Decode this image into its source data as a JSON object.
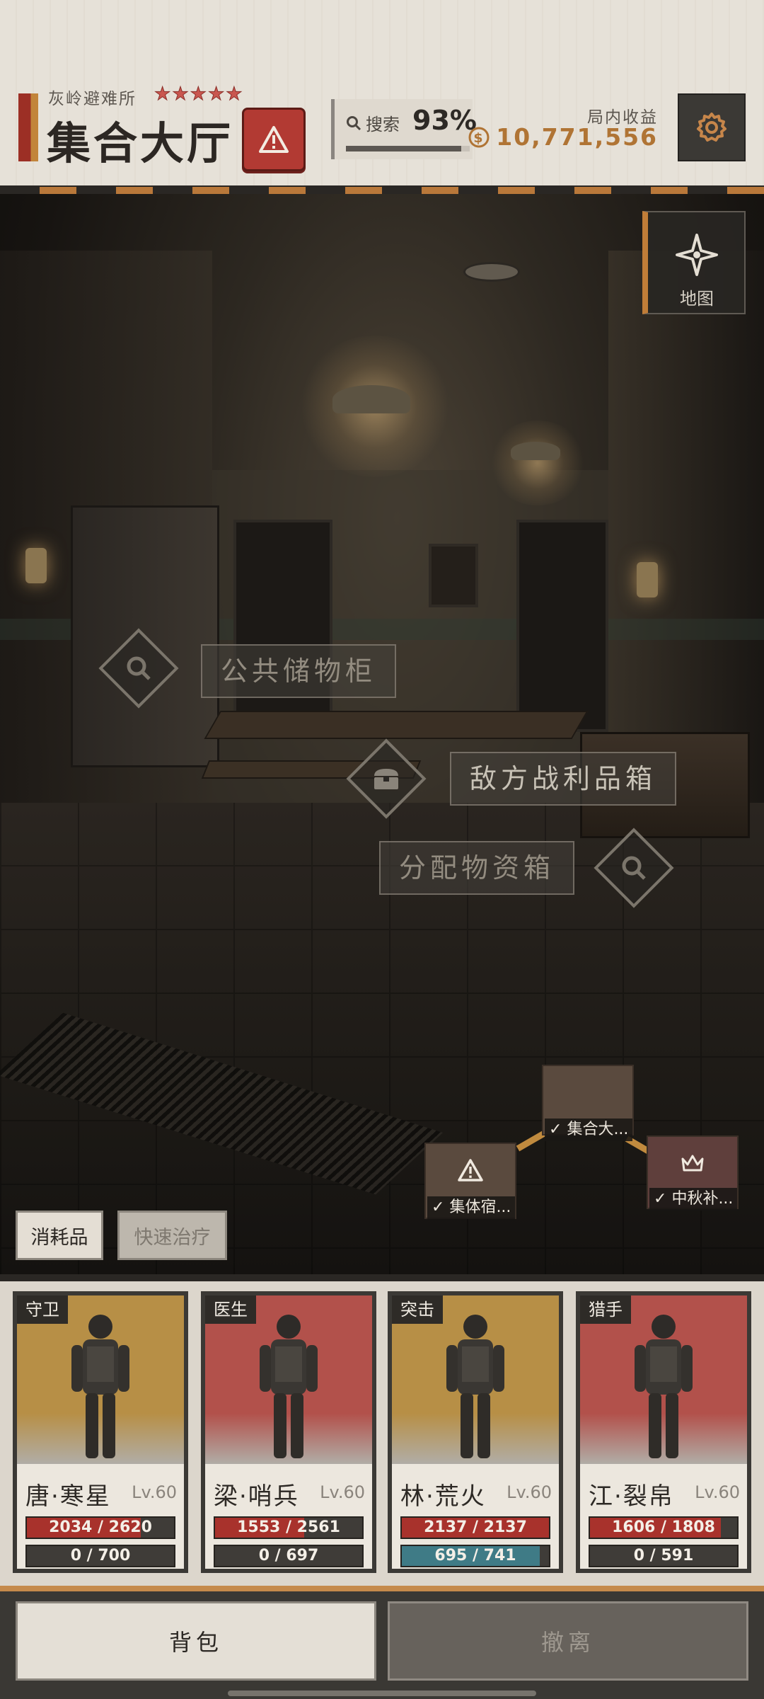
{
  "header": {
    "shelter_name": "灰岭避难所",
    "stars": [
      "★",
      "★",
      "★",
      "★",
      "★"
    ],
    "room_title": "集合大厅",
    "search_label": "搜索",
    "search_pct": "93%",
    "search_progress": 0.93,
    "income_label": "局内收益",
    "income_value": "10,771,556"
  },
  "scene": {
    "map_label": "地图",
    "locations": {
      "locker": "公共储物柜",
      "enemy_loot": "敌方战利品箱",
      "supply": "分配物资箱"
    }
  },
  "minimap": {
    "node_hall": "集合大...",
    "node_dorm": "集体宿...",
    "node_mid": "中秋补..."
  },
  "actions": {
    "consumables": "消耗品",
    "quick_heal": "快速治疗"
  },
  "squad": [
    {
      "role": "守卫",
      "name": "唐·寒星",
      "level": "Lv.60",
      "hp": "2034 / 2620",
      "hp_ratio": 0.776,
      "sp": "0 / 700",
      "sp_ratio": 0,
      "bg": "#b78f46"
    },
    {
      "role": "医生",
      "name": "梁·哨兵",
      "level": "Lv.60",
      "hp": "1553 / 2561",
      "hp_ratio": 0.606,
      "sp": "0 / 697",
      "sp_ratio": 0,
      "bg": "#b2514b"
    },
    {
      "role": "突击",
      "name": "林·荒火",
      "level": "Lv.60",
      "hp": "2137 / 2137",
      "hp_ratio": 1.0,
      "sp": "695 / 741",
      "sp_ratio": 0.938,
      "bg": "#b78f46"
    },
    {
      "role": "猎手",
      "name": "江·裂帛",
      "level": "Lv.60",
      "hp": "1606 / 1808",
      "hp_ratio": 0.888,
      "sp": "0 / 591",
      "sp_ratio": 0,
      "bg": "#b2514b"
    }
  ],
  "bottom": {
    "bag": "背包",
    "evacuate": "撤离"
  },
  "colors": {
    "hp": "#a8322c",
    "sp": "#3f7b86",
    "accent": "#c07d38",
    "alert": "#b23a33"
  }
}
